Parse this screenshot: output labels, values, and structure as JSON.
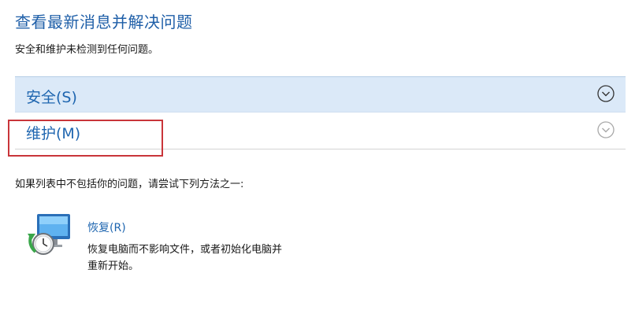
{
  "header": {
    "title": "查看最新消息并解决问题",
    "subtitle": "安全和维护未检测到任何问题。"
  },
  "sections": [
    {
      "label": "安全(S)",
      "expand_icon": "chevron-down-circle-icon"
    },
    {
      "label": "维护(M)",
      "expand_icon": "chevron-down-circle-icon"
    }
  ],
  "hint": "如果列表中不包括你的问题，请尝试下列方法之一:",
  "recovery": {
    "icon": "recovery-monitor-icon",
    "link": "恢复(R)",
    "description": "恢复电脑而不影响文件，或者初始化电脑并重新开始。"
  },
  "colors": {
    "title": "#1f5fa8",
    "link": "#1f66b0",
    "security_background": "#dbe9f8",
    "highlight_box": "#c9353a"
  }
}
